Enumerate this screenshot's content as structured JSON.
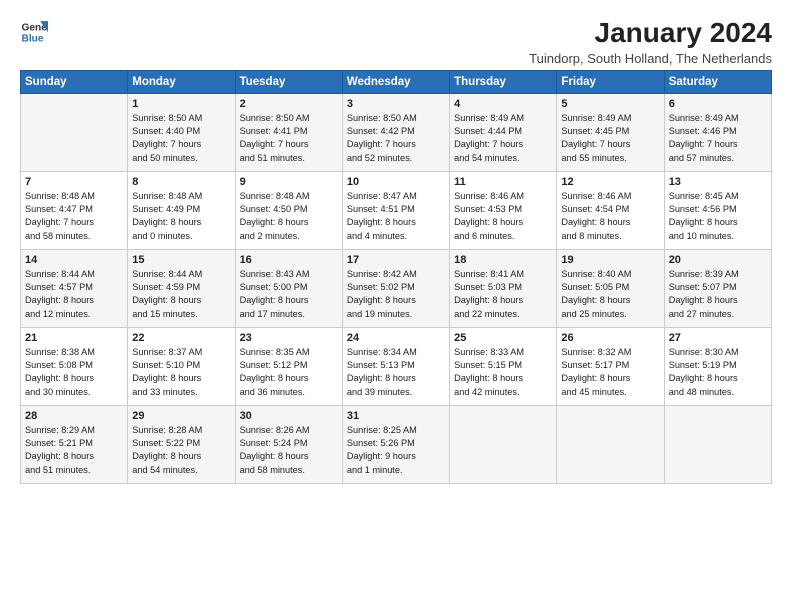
{
  "logo": {
    "general": "General",
    "blue": "Blue"
  },
  "title": "January 2024",
  "subtitle": "Tuindorp, South Holland, The Netherlands",
  "days_header": [
    "Sunday",
    "Monday",
    "Tuesday",
    "Wednesday",
    "Thursday",
    "Friday",
    "Saturday"
  ],
  "weeks": [
    [
      {
        "day": "",
        "info": ""
      },
      {
        "day": "1",
        "info": "Sunrise: 8:50 AM\nSunset: 4:40 PM\nDaylight: 7 hours\nand 50 minutes."
      },
      {
        "day": "2",
        "info": "Sunrise: 8:50 AM\nSunset: 4:41 PM\nDaylight: 7 hours\nand 51 minutes."
      },
      {
        "day": "3",
        "info": "Sunrise: 8:50 AM\nSunset: 4:42 PM\nDaylight: 7 hours\nand 52 minutes."
      },
      {
        "day": "4",
        "info": "Sunrise: 8:49 AM\nSunset: 4:44 PM\nDaylight: 7 hours\nand 54 minutes."
      },
      {
        "day": "5",
        "info": "Sunrise: 8:49 AM\nSunset: 4:45 PM\nDaylight: 7 hours\nand 55 minutes."
      },
      {
        "day": "6",
        "info": "Sunrise: 8:49 AM\nSunset: 4:46 PM\nDaylight: 7 hours\nand 57 minutes."
      }
    ],
    [
      {
        "day": "7",
        "info": "Sunrise: 8:48 AM\nSunset: 4:47 PM\nDaylight: 7 hours\nand 58 minutes."
      },
      {
        "day": "8",
        "info": "Sunrise: 8:48 AM\nSunset: 4:49 PM\nDaylight: 8 hours\nand 0 minutes."
      },
      {
        "day": "9",
        "info": "Sunrise: 8:48 AM\nSunset: 4:50 PM\nDaylight: 8 hours\nand 2 minutes."
      },
      {
        "day": "10",
        "info": "Sunrise: 8:47 AM\nSunset: 4:51 PM\nDaylight: 8 hours\nand 4 minutes."
      },
      {
        "day": "11",
        "info": "Sunrise: 8:46 AM\nSunset: 4:53 PM\nDaylight: 8 hours\nand 6 minutes."
      },
      {
        "day": "12",
        "info": "Sunrise: 8:46 AM\nSunset: 4:54 PM\nDaylight: 8 hours\nand 8 minutes."
      },
      {
        "day": "13",
        "info": "Sunrise: 8:45 AM\nSunset: 4:56 PM\nDaylight: 8 hours\nand 10 minutes."
      }
    ],
    [
      {
        "day": "14",
        "info": "Sunrise: 8:44 AM\nSunset: 4:57 PM\nDaylight: 8 hours\nand 12 minutes."
      },
      {
        "day": "15",
        "info": "Sunrise: 8:44 AM\nSunset: 4:59 PM\nDaylight: 8 hours\nand 15 minutes."
      },
      {
        "day": "16",
        "info": "Sunrise: 8:43 AM\nSunset: 5:00 PM\nDaylight: 8 hours\nand 17 minutes."
      },
      {
        "day": "17",
        "info": "Sunrise: 8:42 AM\nSunset: 5:02 PM\nDaylight: 8 hours\nand 19 minutes."
      },
      {
        "day": "18",
        "info": "Sunrise: 8:41 AM\nSunset: 5:03 PM\nDaylight: 8 hours\nand 22 minutes."
      },
      {
        "day": "19",
        "info": "Sunrise: 8:40 AM\nSunset: 5:05 PM\nDaylight: 8 hours\nand 25 minutes."
      },
      {
        "day": "20",
        "info": "Sunrise: 8:39 AM\nSunset: 5:07 PM\nDaylight: 8 hours\nand 27 minutes."
      }
    ],
    [
      {
        "day": "21",
        "info": "Sunrise: 8:38 AM\nSunset: 5:08 PM\nDaylight: 8 hours\nand 30 minutes."
      },
      {
        "day": "22",
        "info": "Sunrise: 8:37 AM\nSunset: 5:10 PM\nDaylight: 8 hours\nand 33 minutes."
      },
      {
        "day": "23",
        "info": "Sunrise: 8:35 AM\nSunset: 5:12 PM\nDaylight: 8 hours\nand 36 minutes."
      },
      {
        "day": "24",
        "info": "Sunrise: 8:34 AM\nSunset: 5:13 PM\nDaylight: 8 hours\nand 39 minutes."
      },
      {
        "day": "25",
        "info": "Sunrise: 8:33 AM\nSunset: 5:15 PM\nDaylight: 8 hours\nand 42 minutes."
      },
      {
        "day": "26",
        "info": "Sunrise: 8:32 AM\nSunset: 5:17 PM\nDaylight: 8 hours\nand 45 minutes."
      },
      {
        "day": "27",
        "info": "Sunrise: 8:30 AM\nSunset: 5:19 PM\nDaylight: 8 hours\nand 48 minutes."
      }
    ],
    [
      {
        "day": "28",
        "info": "Sunrise: 8:29 AM\nSunset: 5:21 PM\nDaylight: 8 hours\nand 51 minutes."
      },
      {
        "day": "29",
        "info": "Sunrise: 8:28 AM\nSunset: 5:22 PM\nDaylight: 8 hours\nand 54 minutes."
      },
      {
        "day": "30",
        "info": "Sunrise: 8:26 AM\nSunset: 5:24 PM\nDaylight: 8 hours\nand 58 minutes."
      },
      {
        "day": "31",
        "info": "Sunrise: 8:25 AM\nSunset: 5:26 PM\nDaylight: 9 hours\nand 1 minute."
      },
      {
        "day": "",
        "info": ""
      },
      {
        "day": "",
        "info": ""
      },
      {
        "day": "",
        "info": ""
      }
    ]
  ]
}
